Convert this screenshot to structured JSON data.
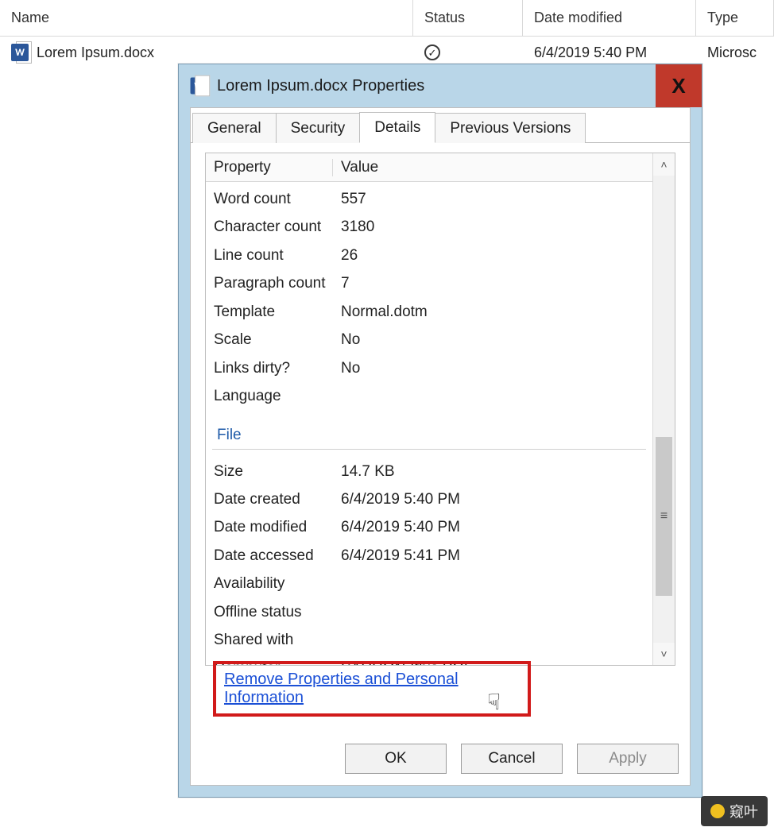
{
  "explorer": {
    "columns": {
      "name": "Name",
      "status": "Status",
      "date": "Date modified",
      "type": "Type"
    },
    "row": {
      "filename": "Lorem Ipsum.docx",
      "date": "6/4/2019 5:40 PM",
      "type": "Microsc"
    }
  },
  "dialog": {
    "title": "Lorem Ipsum.docx Properties",
    "close": "X",
    "tabs": {
      "general": "General",
      "security": "Security",
      "details": "Details",
      "previous": "Previous Versions"
    },
    "headers": {
      "property": "Property",
      "value": "Value"
    },
    "rows_top": [
      {
        "k": "Word count",
        "v": "557"
      },
      {
        "k": "Character count",
        "v": "3180"
      },
      {
        "k": "Line count",
        "v": "26"
      },
      {
        "k": "Paragraph count",
        "v": "7"
      },
      {
        "k": "Template",
        "v": "Normal.dotm"
      },
      {
        "k": "Scale",
        "v": "No"
      },
      {
        "k": "Links dirty?",
        "v": "No"
      },
      {
        "k": "Language",
        "v": ""
      }
    ],
    "section_file": "File",
    "rows_file": [
      {
        "k": "Size",
        "v": "14.7 KB"
      },
      {
        "k": "Date created",
        "v": "6/4/2019 5:40 PM"
      },
      {
        "k": "Date modified",
        "v": "6/4/2019 5:40 PM"
      },
      {
        "k": "Date accessed",
        "v": "6/4/2019 5:41 PM"
      },
      {
        "k": "Availability",
        "v": ""
      },
      {
        "k": "Offline status",
        "v": ""
      },
      {
        "k": "Shared with",
        "v": ""
      },
      {
        "k": "Computer",
        "v": "SAURON (this PC)"
      }
    ],
    "remove_link": "Remove Properties and Personal Information",
    "buttons": {
      "ok": "OK",
      "cancel": "Cancel",
      "apply": "Apply"
    }
  },
  "watermark": "窥叶"
}
